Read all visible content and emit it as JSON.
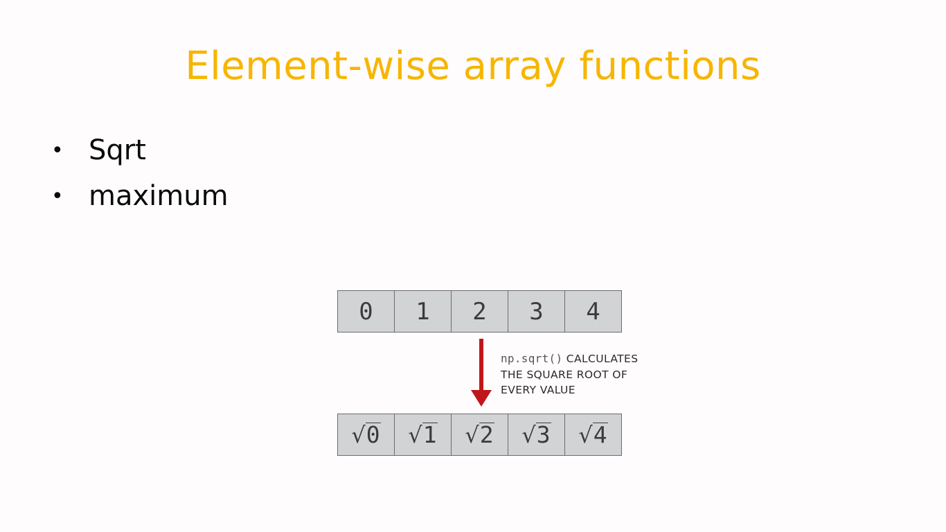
{
  "slide": {
    "title": "Element-wise array functions",
    "bullets": [
      "Sqrt",
      "maximum"
    ]
  },
  "diagram": {
    "input_values": [
      "0",
      "1",
      "2",
      "3",
      "4"
    ],
    "output_values": [
      "0",
      "1",
      "2",
      "3",
      "4"
    ],
    "output_operator": "√",
    "caption": {
      "code": "np.sqrt()",
      "line1_rest": " CALCULATES",
      "line2": "THE SQUARE ROOT OF",
      "line3": "EVERY VALUE"
    }
  },
  "colors": {
    "title": "#f7b500",
    "arrow": "#c0161b",
    "cell_fill": "#d2d3d4"
  }
}
